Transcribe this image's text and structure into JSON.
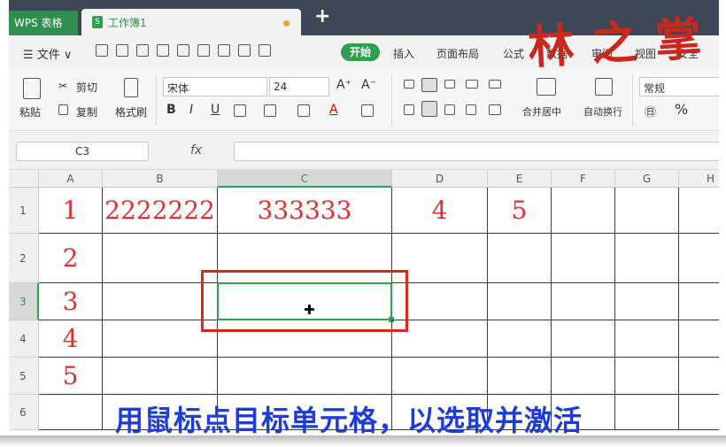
{
  "titlebar": {
    "app_tab": "WPS 表格",
    "doc_tab": "工作簿1",
    "new_tab": "+"
  },
  "menubar": {
    "file": "☰ 文件 ∨",
    "start": "开始",
    "items": [
      "插入",
      "页面布局",
      "公式",
      "数据",
      "审阅",
      "视图",
      "安全"
    ]
  },
  "watermark": "林之掌",
  "ribbon": {
    "paste": "粘贴",
    "cut": "剪切",
    "copy": "复制",
    "format_painter": "格式刷",
    "font_name": "宋体",
    "font_size": "24",
    "grow_font": "A⁺",
    "shrink_font": "A⁻",
    "bold": "B",
    "italic": "I",
    "underline": "U",
    "merge_center": "合并居中",
    "wrap_text": "自动换行",
    "number_format": "常规",
    "percent": "%"
  },
  "formula_bar": {
    "name_box": "C3",
    "fx": "fx",
    "formula": ""
  },
  "columns": [
    "A",
    "B",
    "C",
    "D",
    "E",
    "F",
    "G",
    "H"
  ],
  "rows": [
    "1",
    "2",
    "3",
    "4",
    "5",
    "6"
  ],
  "cells": {
    "A1": "1",
    "B1": "2222222",
    "C1": "333333",
    "D1": "4",
    "E1": "5",
    "A2": "2",
    "A3": "3",
    "A4": "4",
    "A5": "5"
  },
  "selected_cell": "C3",
  "caption": "用鼠标点目标单元格，以选取并激活",
  "colors": {
    "accent_green": "#2fa04f",
    "cell_text_red": "#e03030",
    "highlight_red": "#d8291b",
    "caption_blue": "#1e3cd8"
  }
}
